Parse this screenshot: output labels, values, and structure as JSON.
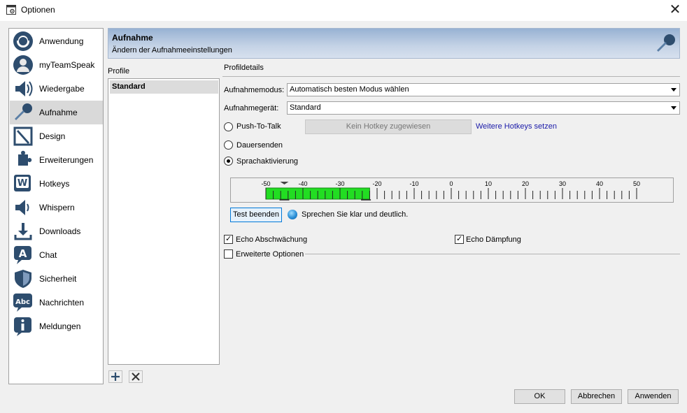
{
  "window": {
    "title": "Optionen",
    "close_glyph": "✕"
  },
  "sidebar": {
    "items": [
      {
        "label": "Anwendung",
        "icon": "headset-icon"
      },
      {
        "label": "myTeamSpeak",
        "icon": "user-icon"
      },
      {
        "label": "Wiedergabe",
        "icon": "speaker-icon"
      },
      {
        "label": "Aufnahme",
        "icon": "microphone-icon",
        "selected": true
      },
      {
        "label": "Design",
        "icon": "design-icon"
      },
      {
        "label": "Erweiterungen",
        "icon": "puzzle-icon"
      },
      {
        "label": "Hotkeys",
        "icon": "hotkey-icon"
      },
      {
        "label": "Whispern",
        "icon": "whisper-icon"
      },
      {
        "label": "Downloads",
        "icon": "download-icon"
      },
      {
        "label": "Chat",
        "icon": "chat-icon"
      },
      {
        "label": "Sicherheit",
        "icon": "shield-icon"
      },
      {
        "label": "Nachrichten",
        "icon": "message-icon"
      },
      {
        "label": "Meldungen",
        "icon": "info-icon"
      }
    ]
  },
  "header": {
    "title": "Aufnahme",
    "subtitle": "Ändern der Aufnahmeeinstellungen"
  },
  "profiles": {
    "label": "Profile",
    "items": [
      "Standard"
    ]
  },
  "details": {
    "label": "Profildetails",
    "mode_label": "Aufnahmemodus:",
    "mode_value": "Automatisch besten Modus wählen",
    "device_label": "Aufnahmegerät:",
    "device_value": "Standard",
    "ptt_label": "Push-To-Talk",
    "hotkey_button": "Kein Hotkey zugewiesen",
    "more_hotkeys": "Weitere Hotkeys setzen",
    "continuous_label": "Dauersenden",
    "voice_activation_label": "Sprachaktivierung",
    "meter": {
      "ticks": [
        "-50",
        "-40",
        "-30",
        "-20",
        "-10",
        "0",
        "10",
        "20",
        "30",
        "40",
        "50"
      ],
      "range": [
        -50,
        50
      ],
      "level": -22
    },
    "test_button": "Test beenden",
    "status_text": "Sprechen Sie klar und deutlich.",
    "echo_reduction": "Echo Abschwächung",
    "echo_cancel": "Echo Dämpfung",
    "advanced": "Erweiterte Optionen"
  },
  "buttons": {
    "ok": "OK",
    "cancel": "Abbrechen",
    "apply": "Anwenden"
  }
}
